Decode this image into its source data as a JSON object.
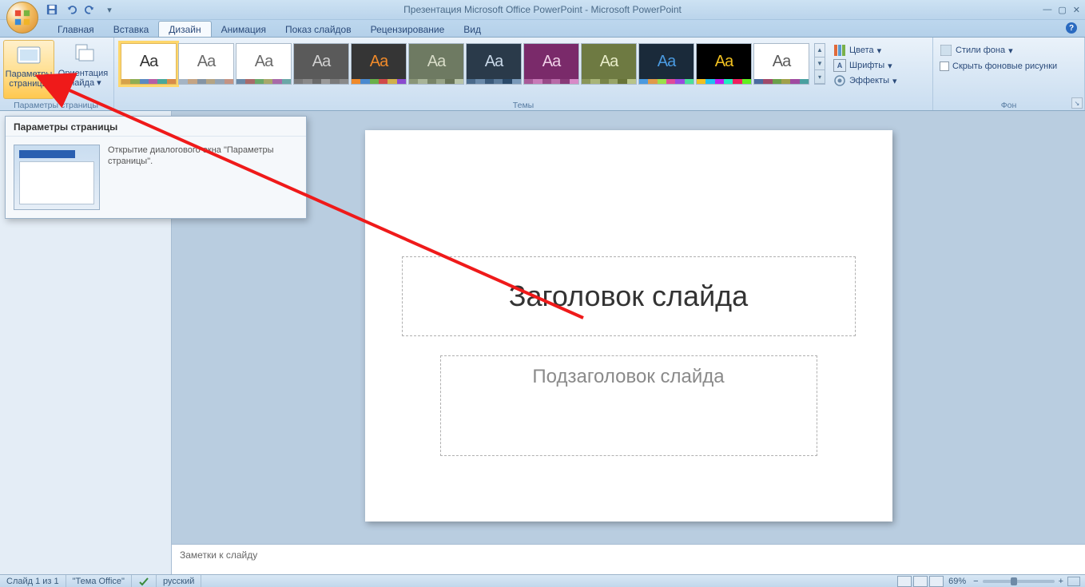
{
  "title": {
    "doc": "Презентация Microsoft Office PowerPoint",
    "app": "Microsoft PowerPoint"
  },
  "tabs": {
    "items": [
      "Главная",
      "Вставка",
      "Дизайн",
      "Анимация",
      "Показ слайдов",
      "Рецензирование",
      "Вид"
    ],
    "active_index": 2
  },
  "ribbon": {
    "page_setup": {
      "label": "Параметры страницы",
      "btn_page_setup_line1": "Параметры",
      "btn_page_setup_line2": "страницы",
      "btn_orientation_line1": "Ориентация",
      "btn_orientation_line2": "слайда"
    },
    "themes": {
      "label": "Темы",
      "colors": "Цвета",
      "fonts": "Шрифты",
      "effects": "Эффекты"
    },
    "background": {
      "label": "Фон",
      "styles": "Стили фона",
      "hide_bg": "Скрыть фоновые рисунки"
    }
  },
  "tooltip": {
    "title": "Параметры страницы",
    "text": "Открытие диалогового окна \"Параметры страницы\"."
  },
  "slide": {
    "title_placeholder": "Заголовок слайда",
    "subtitle_placeholder": "Подзаголовок слайда"
  },
  "notes": {
    "placeholder": "Заметки к слайду"
  },
  "status": {
    "slide": "Слайд 1 из 1",
    "theme": "\"Тема Office\"",
    "lang": "русский",
    "zoom": "69%"
  },
  "theme_gallery": [
    {
      "bg": "#ffffff",
      "fg": "#333333",
      "strip": [
        "#d6a24a",
        "#8fae54",
        "#5b8ac0",
        "#b55ea6",
        "#4aa89a",
        "#d78b4a"
      ]
    },
    {
      "bg": "#ffffff",
      "fg": "#6a6a6a",
      "strip": [
        "#a4b4c4",
        "#c4a484",
        "#8494a4",
        "#b4a484",
        "#94a4b4",
        "#c49484"
      ]
    },
    {
      "bg": "#ffffff",
      "fg": "#6a6a6a",
      "strip": [
        "#6a8aa8",
        "#a86a6a",
        "#6aa86a",
        "#a8a86a",
        "#a86aa8",
        "#6aa8a8"
      ]
    },
    {
      "bg": "#5a5a5a",
      "fg": "#d0d0d0",
      "strip": [
        "#7a7a7a",
        "#8a8a8a",
        "#6a6a6a",
        "#9a9a9a",
        "#7a7a7a",
        "#8a8a8a"
      ]
    },
    {
      "bg": "#353535",
      "fg": "#f08a2a",
      "strip": [
        "#f08a2a",
        "#4a8ad0",
        "#6ab04a",
        "#d04a4a",
        "#d0b04a",
        "#8a4ad0"
      ]
    },
    {
      "bg": "#6e7a62",
      "fg": "#d8dcc8",
      "strip": [
        "#8a9678",
        "#a8b498",
        "#788468",
        "#98a488",
        "#687458",
        "#b8c4a8"
      ]
    },
    {
      "bg": "#2a3a4a",
      "fg": "#c8d8e8",
      "strip": [
        "#4a6a8a",
        "#6a8aaa",
        "#3a5a7a",
        "#5a7a9a",
        "#2a4a6a",
        "#7a9aba"
      ]
    },
    {
      "bg": "#7a2a6a",
      "fg": "#f0d0e8",
      "strip": [
        "#a85a98",
        "#c87ab8",
        "#984a88",
        "#b86aa8",
        "#883a78",
        "#d88ac8"
      ]
    },
    {
      "bg": "#6e7a42",
      "fg": "#e8ecc8",
      "strip": [
        "#8a9658",
        "#a8b478",
        "#788448",
        "#98a468",
        "#687438",
        "#b8c488"
      ]
    },
    {
      "bg": "#1a2a3a",
      "fg": "#4a9ae0",
      "strip": [
        "#4a9ae0",
        "#e09a4a",
        "#9ae04a",
        "#e04a9a",
        "#9a4ae0",
        "#4ae09a"
      ]
    },
    {
      "bg": "#000000",
      "fg": "#f0c020",
      "strip": [
        "#f0c020",
        "#20c0f0",
        "#c020f0",
        "#20f0c0",
        "#f02060",
        "#60f020"
      ]
    },
    {
      "bg": "#ffffff",
      "fg": "#5a5a5a",
      "strip": [
        "#4a6aa0",
        "#a04a6a",
        "#6aa04a",
        "#a0a04a",
        "#a04aa0",
        "#4aa0a0"
      ]
    }
  ]
}
